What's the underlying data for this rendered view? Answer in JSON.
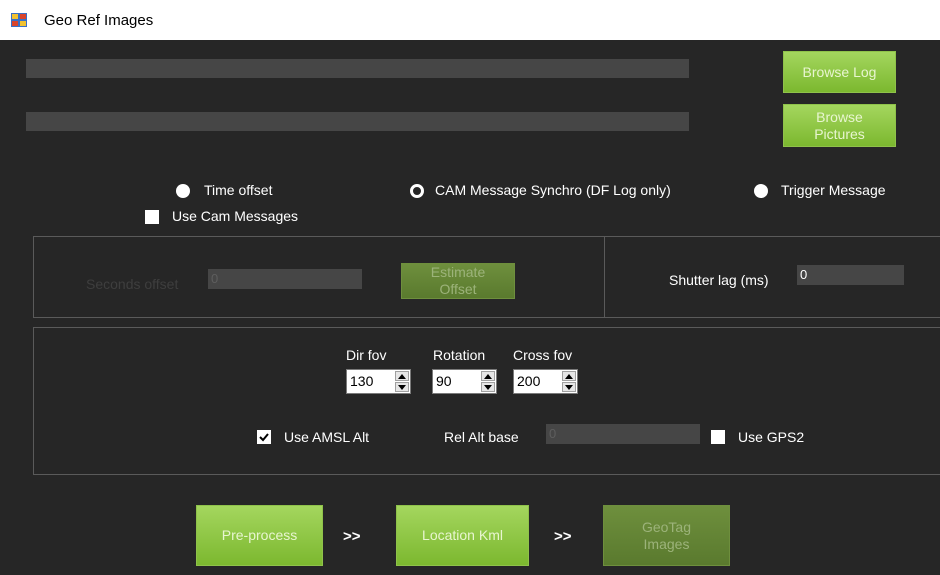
{
  "window": {
    "title": "Geo Ref Images"
  },
  "paths": {
    "log_path": "",
    "pictures_path": ""
  },
  "buttons": {
    "browse_log": "Browse Log",
    "browse_pictures": "Browse Pictures",
    "estimate_offset": "Estimate Offset",
    "pre_process": "Pre-process",
    "location_kml": "Location Kml",
    "geotag_images": "GeoTag Images"
  },
  "modes": {
    "time_offset": "Time offset",
    "cam_message_synchro": "CAM Message Synchro (DF Log only)",
    "trigger_message": "Trigger Message",
    "use_cam_messages": "Use Cam Messages",
    "selected": "cam_message_synchro"
  },
  "offset": {
    "seconds_offset_label": "Seconds offset",
    "seconds_offset_value": "0",
    "shutter_lag_label": "Shutter lag (ms)",
    "shutter_lag_value": "0"
  },
  "camera": {
    "dir_fov_label": "Dir fov",
    "dir_fov_value": "130",
    "rotation_label": "Rotation",
    "rotation_value": "90",
    "cross_fov_label": "Cross fov",
    "cross_fov_value": "200"
  },
  "altitude": {
    "use_amsl_alt": "Use AMSL Alt",
    "use_amsl_checked": true,
    "rel_alt_base_label": "Rel Alt base",
    "rel_alt_base_value": "0",
    "use_gps2": "Use GPS2",
    "use_gps2_checked": false
  },
  "steps": {
    "separator": ">>"
  },
  "colors": {
    "background": "#262626",
    "button_green": "#8cc63f",
    "field": "#464646"
  }
}
